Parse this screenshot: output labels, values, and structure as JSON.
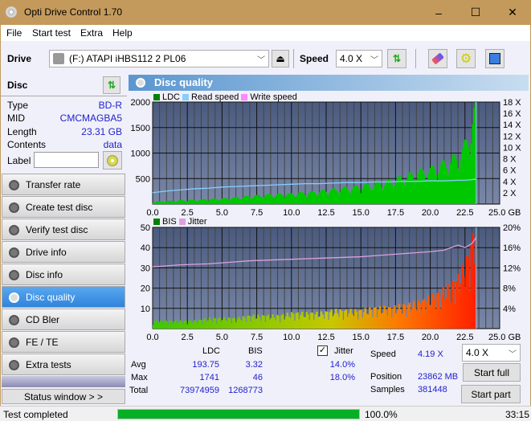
{
  "window": {
    "title": "Opti Drive Control 1.70",
    "minimize": "–",
    "maximize": "☐",
    "close": "✕"
  },
  "menu": [
    "File",
    "Start test",
    "Extra",
    "Help"
  ],
  "toolbar": {
    "drive_label": "Drive",
    "drive_value": "(F:)  ATAPI iHBS112   2 PL06",
    "speed_label": "Speed",
    "speed_value": "4.0 X"
  },
  "disc": {
    "header": "Disc",
    "fields": [
      {
        "k": "Type",
        "v": "BD-R"
      },
      {
        "k": "MID",
        "v": "CMCMAGBA5"
      },
      {
        "k": "Length",
        "v": "23.31 GB"
      },
      {
        "k": "Contents",
        "v": "data"
      }
    ],
    "label_key": "Label",
    "label_value": ""
  },
  "nav": [
    {
      "label": "Transfer rate",
      "active": false
    },
    {
      "label": "Create test disc",
      "active": false
    },
    {
      "label": "Verify test disc",
      "active": false
    },
    {
      "label": "Drive info",
      "active": false
    },
    {
      "label": "Disc info",
      "active": false
    },
    {
      "label": "Disc quality",
      "active": true
    },
    {
      "label": "CD Bler",
      "active": false
    },
    {
      "label": "FE / TE",
      "active": false
    },
    {
      "label": "Extra tests",
      "active": false
    }
  ],
  "status_window_btn": "Status window > >",
  "panel_title": "Disc quality",
  "chart_data": [
    {
      "type": "area",
      "title": "LDC",
      "legend": [
        "LDC",
        "Read speed",
        "Write speed"
      ],
      "legend_colors": [
        "#008000",
        "#87cefa",
        "#ff88ff"
      ],
      "x": [
        0,
        1,
        2,
        3,
        4,
        5,
        6,
        7,
        8,
        9,
        10,
        11,
        12,
        13,
        14,
        15,
        16,
        17,
        18,
        19,
        20,
        21,
        22,
        22.5,
        23,
        23.31
      ],
      "ldc": [
        40,
        50,
        60,
        70,
        80,
        90,
        110,
        130,
        150,
        160,
        170,
        190,
        210,
        240,
        270,
        300,
        340,
        380,
        450,
        520,
        580,
        680,
        800,
        1000,
        1400,
        1700
      ],
      "read_speed_x": [
        2,
        2.3,
        2.5,
        2.7,
        2.8,
        3,
        3.1,
        3.2,
        3.3,
        3.4,
        3.5,
        3.6,
        3.6,
        3.7,
        3.8,
        3.8,
        3.9,
        3.9,
        4.0,
        4.0,
        4.1,
        4.1,
        4.2,
        4.2,
        4.3,
        4.4
      ],
      "xlim": [
        0,
        25
      ],
      "ylim": [
        0,
        2000
      ],
      "y2lim": [
        0,
        18
      ],
      "xlabel": "GB",
      "xticks": [
        "0.0",
        "2.5",
        "5.0",
        "7.5",
        "10.0",
        "12.5",
        "15.0",
        "17.5",
        "20.0",
        "22.5",
        "25.0 GB"
      ],
      "yticks": [
        "500",
        "1000",
        "1500",
        "2000"
      ],
      "y2ticks": [
        "2 X",
        "4 X",
        "6 X",
        "8 X",
        "10 X",
        "12 X",
        "14 X",
        "16 X",
        "18 X"
      ]
    },
    {
      "type": "area",
      "title": "BIS",
      "legend": [
        "BIS",
        "Jitter"
      ],
      "legend_colors": [
        "#008000",
        "#dda0dd"
      ],
      "x": [
        0,
        1,
        2,
        3,
        4,
        5,
        6,
        7,
        8,
        9,
        10,
        11,
        12,
        13,
        14,
        15,
        16,
        17,
        18,
        19,
        20,
        21,
        22,
        22.5,
        23,
        23.31
      ],
      "bis": [
        3,
        3,
        3,
        3,
        4,
        4,
        4,
        5,
        5,
        5,
        6,
        6,
        6,
        7,
        7,
        7,
        8,
        8,
        9,
        10,
        12,
        15,
        20,
        25,
        35,
        46
      ],
      "jitter_pct": [
        12.2,
        12.4,
        12.6,
        12.7,
        12.8,
        13,
        13.2,
        13.4,
        13.5,
        13.6,
        13.7,
        13.8,
        13.9,
        14,
        14.1,
        14.2,
        14.4,
        14.6,
        14.8,
        15,
        15.2,
        15.5,
        16.5,
        16.0,
        16.8,
        18.0
      ],
      "xlim": [
        0,
        25
      ],
      "ylim": [
        0,
        50
      ],
      "y2lim": [
        0,
        20
      ],
      "xticks": [
        "0.0",
        "2.5",
        "5.0",
        "7.5",
        "10.0",
        "12.5",
        "15.0",
        "17.5",
        "20.0",
        "22.5",
        "25.0 GB"
      ],
      "yticks": [
        "10",
        "20",
        "30",
        "40",
        "50"
      ],
      "y2ticks": [
        "4%",
        "8%",
        "12%",
        "16%",
        "20%"
      ]
    }
  ],
  "stats": {
    "col_ldc": "LDC",
    "col_bis": "BIS",
    "jitter_label": "Jitter",
    "jitter_checked": true,
    "rows": [
      {
        "k": "Avg",
        "ldc": "193.75",
        "bis": "3.32",
        "jit": "14.0%"
      },
      {
        "k": "Max",
        "ldc": "1741",
        "bis": "46",
        "jit": "18.0%"
      },
      {
        "k": "Total",
        "ldc": "73974959",
        "bis": "1268773",
        "jit": ""
      }
    ],
    "speed_label": "Speed",
    "speed_value": "4.19 X",
    "position_label": "Position",
    "position_value": "23862 MB",
    "samples_label": "Samples",
    "samples_value": "381448",
    "speed_select": "4.0 X",
    "start_full": "Start full",
    "start_part": "Start part"
  },
  "status": {
    "text": "Test completed",
    "progress_pct": 100,
    "progress_label": "100.0%",
    "time": "33:15"
  }
}
